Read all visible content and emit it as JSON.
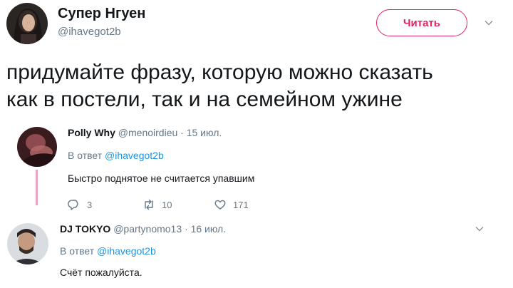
{
  "main_tweet": {
    "author_name": "Супер Нгуен",
    "author_handle": "@ihavegot2b",
    "follow_label": "Читать",
    "text_line1": "придумайте фразу, которую можно сказать",
    "text_line2": "как в постели, так и на семейном ужине"
  },
  "replies": [
    {
      "author_name": "Polly Why",
      "author_handle": "@menoirdieu",
      "date": "· 15 июл.",
      "reply_to_prefix": "В ответ",
      "reply_to_handle": "@ihavegot2b",
      "text": "Быстро поднятое не считается упавшим",
      "reply_count": "3",
      "retweet_count": "10",
      "like_count": "171"
    },
    {
      "author_name": "DJ TOKYO",
      "author_handle": "@partynomo13",
      "date": "· 16 июл.",
      "reply_to_prefix": "В ответ",
      "reply_to_handle": "@ihavegot2b",
      "text": "Счёт пожалуйста."
    }
  ],
  "colors": {
    "follow_accent": "#e0245e",
    "link": "#1b95e0",
    "muted": "#657786",
    "thread_line": "#e8a6c4"
  },
  "icons": [
    "chevron-down-icon",
    "reply-icon",
    "retweet-icon",
    "like-icon"
  ]
}
